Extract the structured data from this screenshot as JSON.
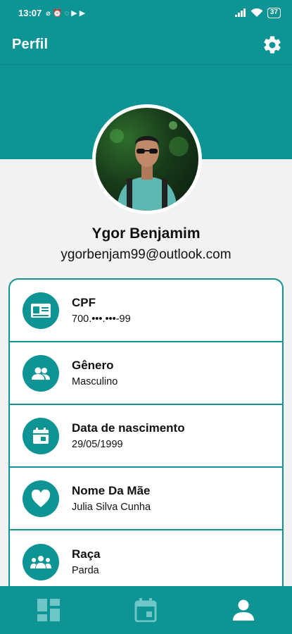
{
  "status_bar": {
    "time": "13:07",
    "battery": "37"
  },
  "app_bar": {
    "title": "Perfil"
  },
  "profile": {
    "name": "Ygor Benjamim",
    "email": "ygorbenjam99@outlook.com"
  },
  "info_rows": [
    {
      "label": "CPF",
      "value": "700.•••.•••-99",
      "icon": "id-card-icon"
    },
    {
      "label": "Gênero",
      "value": "Masculino",
      "icon": "people-icon"
    },
    {
      "label": "Data de nascimento",
      "value": "29/05/1999",
      "icon": "calendar-icon"
    },
    {
      "label": "Nome Da Mãe",
      "value": "Julia Silva Cunha",
      "icon": "heart-icon"
    },
    {
      "label": "Raça",
      "value": "Parda",
      "icon": "group-icon"
    }
  ],
  "bottom_nav": [
    {
      "icon": "dashboard-icon",
      "active": false
    },
    {
      "icon": "calendar-icon",
      "active": false
    },
    {
      "icon": "person-icon",
      "active": true
    }
  ],
  "colors": {
    "primary": "#0e9494",
    "inactive_nav": "#6fc6c6",
    "background": "#f2f2f2"
  }
}
